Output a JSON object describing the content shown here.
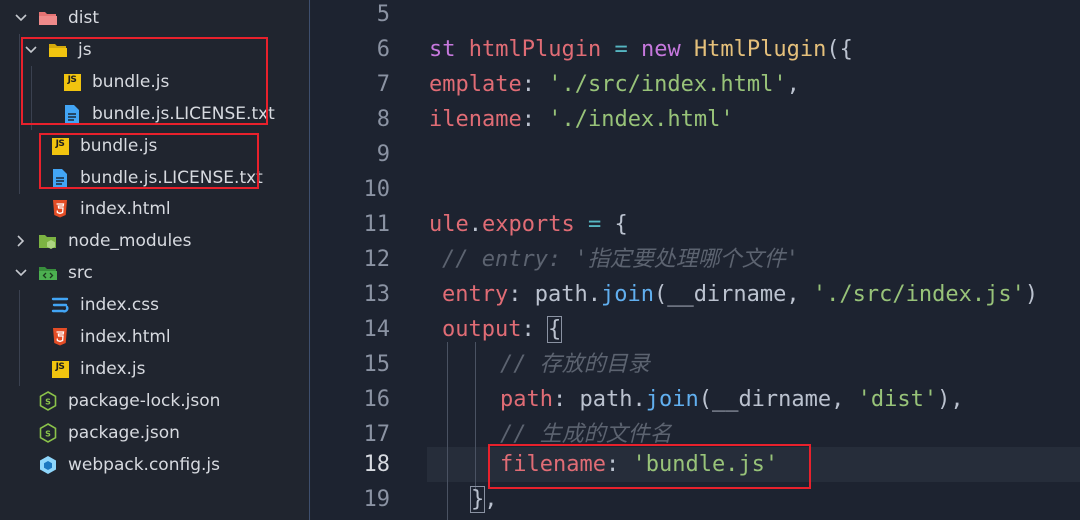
{
  "explorer": {
    "items": [
      {
        "label": "dist",
        "kind": "folder-open",
        "expanded": true
      },
      {
        "label": "js",
        "kind": "folder-open",
        "expanded": true
      },
      {
        "label": "bundle.js",
        "kind": "js"
      },
      {
        "label": "bundle.js.LICENSE.txt",
        "kind": "txt"
      },
      {
        "label": "bundle.js",
        "kind": "js"
      },
      {
        "label": "bundle.js.LICENSE.txt",
        "kind": "txt"
      },
      {
        "label": "index.html",
        "kind": "html"
      },
      {
        "label": "node_modules",
        "kind": "folder",
        "expanded": false
      },
      {
        "label": "src",
        "kind": "folder-open",
        "expanded": true
      },
      {
        "label": "index.css",
        "kind": "css"
      },
      {
        "label": "index.html",
        "kind": "html"
      },
      {
        "label": "index.js",
        "kind": "js"
      },
      {
        "label": "package-lock.json",
        "kind": "json"
      },
      {
        "label": "package.json",
        "kind": "json"
      },
      {
        "label": "webpack.config.js",
        "kind": "webpack"
      }
    ]
  },
  "icons": {
    "js_badge": "JS"
  },
  "editor": {
    "line_numbers": [
      "5",
      "6",
      "7",
      "8",
      "9",
      "10",
      "11",
      "12",
      "13",
      "14",
      "15",
      "16",
      "17",
      "18",
      "19"
    ],
    "active_line": "18",
    "lines": {
      "l6": [
        "st ",
        "htmlPlugin",
        " = ",
        "new ",
        "HtmlPlugin",
        "({"
      ],
      "l7": [
        "emplate",
        ": ",
        "'./src/index.html'",
        ","
      ],
      "l8": [
        "ilename",
        ": ",
        "'./index.html'"
      ],
      "l11": [
        "ule",
        ".",
        "exports",
        " = ",
        "{"
      ],
      "l12": [
        "// entry: '指定要处理哪个文件'"
      ],
      "l13": [
        "entry",
        ": ",
        "path",
        ".",
        "join",
        "(__dirname, ",
        "'./src/index.js'",
        ")"
      ],
      "l14": [
        "output",
        ": ",
        "{"
      ],
      "l15": [
        "// 存放的目录"
      ],
      "l16": [
        "path",
        ": ",
        "path",
        ".",
        "join",
        "(__dirname, ",
        "'dist'",
        "),"
      ],
      "l17": [
        "// 生成的文件名"
      ],
      "l18": [
        "filename",
        ": ",
        "'bundle.js'"
      ],
      "l19": [
        "}",
        ","
      ]
    }
  },
  "colors": {
    "highlight_box": "#e8212c",
    "folder_dist": "#e57373",
    "folder_js": "#f1c40f",
    "folder_node": "#8bc34a",
    "folder_src": "#4caf50",
    "js_icon": "#f1c40f",
    "txt_icon": "#42a5f5",
    "html_icon": "#e44d26",
    "css_icon": "#42a5f5",
    "json_icon": "#8bc34a",
    "webpack_icon": "#8ed6fb"
  }
}
